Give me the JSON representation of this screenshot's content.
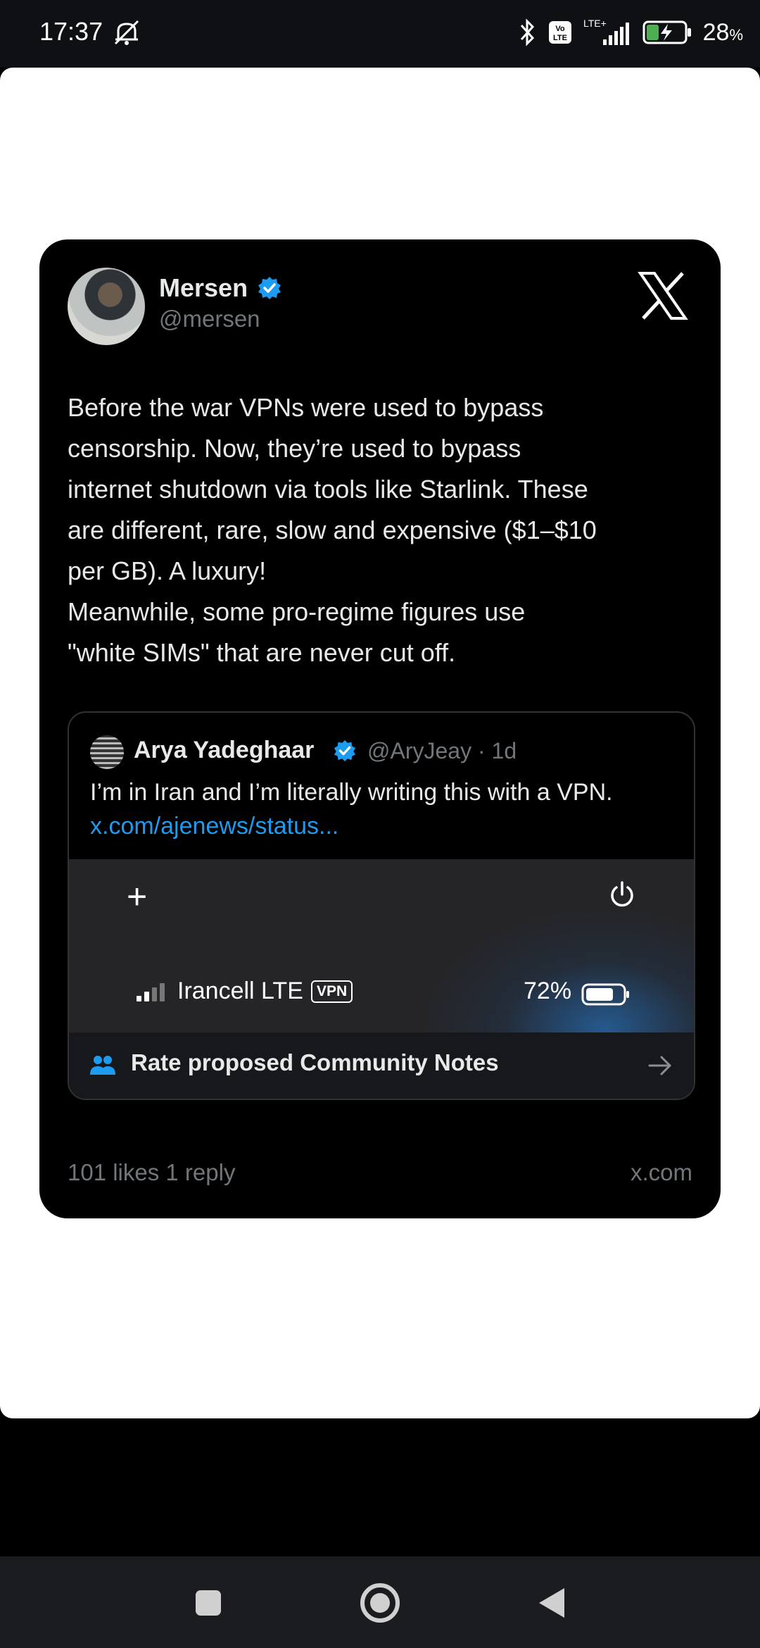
{
  "status_bar": {
    "time": "17:37",
    "volte_label": "Vo LTE",
    "network_label": "LTE+",
    "battery_percent": "28",
    "battery_unit": "%"
  },
  "tweet": {
    "author_name": "Mersen",
    "author_handle": "@mersen",
    "text": "Before the war VPNs were used to bypass\ncensorship. Now, they’re used to bypass\ninternet shutdown via tools like Starlink. These\nare different, rare, slow and expensive ($1–$10\nper GB). A luxury!\nMeanwhile, some pro-regime figures use\n\"white SIMs\" that are never cut off.",
    "stats": "101 likes  1 reply",
    "domain": "x.com"
  },
  "quoted_tweet": {
    "author_name": "Arya Yadeghaar",
    "handle_time": "@AryJeay · 1d",
    "text": "I’m in Iran and I’m literally writing this with a VPN.",
    "link": "x.com/ajenews/status..."
  },
  "media": {
    "plus": "+",
    "carrier": "Irancell LTE",
    "vpn_badge": "VPN",
    "battery": "72%"
  },
  "community_notes": {
    "label": "Rate proposed Community Notes"
  },
  "colors": {
    "accent_blue": "#1d9bf0",
    "muted": "#71767b",
    "card_bg": "#000000"
  },
  "icons": [
    "muted-bell-icon",
    "bluetooth-icon",
    "volte-icon",
    "signal-icon",
    "battery-charging-icon",
    "verified-badge-icon",
    "x-logo-icon",
    "power-icon",
    "battery-icon",
    "community-notes-icon",
    "arrow-right-icon",
    "nav-recents-icon",
    "nav-home-icon",
    "nav-back-icon"
  ]
}
